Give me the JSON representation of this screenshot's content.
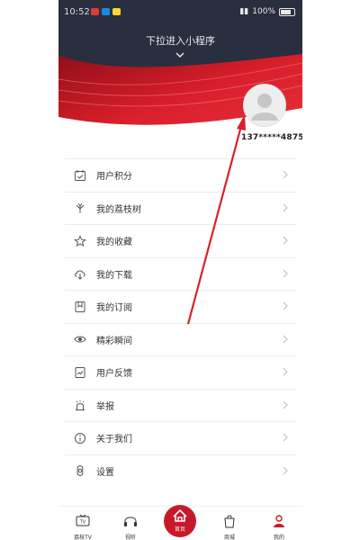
{
  "status_bar": {
    "time": "10:52",
    "battery": "100%"
  },
  "header": {
    "pull_hint": "下拉进入小程序"
  },
  "profile": {
    "phone": "137*****4875"
  },
  "menu": [
    {
      "label": "用户积分",
      "icon": "calendar-check-icon"
    },
    {
      "label": "我的荔枝树",
      "icon": "tree-icon"
    },
    {
      "label": "我的收藏",
      "icon": "star-icon"
    },
    {
      "label": "我的下载",
      "icon": "cloud-download-icon"
    },
    {
      "label": "我的订阅",
      "icon": "bookmark-icon"
    },
    {
      "label": "精彩瞬间",
      "icon": "eye-icon"
    },
    {
      "label": "用户反馈",
      "icon": "feedback-icon"
    },
    {
      "label": "举报",
      "icon": "alarm-icon"
    },
    {
      "label": "关于我们",
      "icon": "info-icon"
    },
    {
      "label": "设置",
      "icon": "gear-icon"
    }
  ],
  "tabs": [
    {
      "label": "荔枝TV",
      "icon": "tv-icon"
    },
    {
      "label": "视听",
      "icon": "headphones-icon"
    },
    {
      "label": "首页",
      "icon": "home-icon"
    },
    {
      "label": "商城",
      "icon": "shopping-bag-icon"
    },
    {
      "label": "我的",
      "icon": "user-icon"
    }
  ],
  "colors": {
    "accent": "#c8192a",
    "header_dark": "#2a2f3f",
    "annotation": "#d9202a"
  }
}
